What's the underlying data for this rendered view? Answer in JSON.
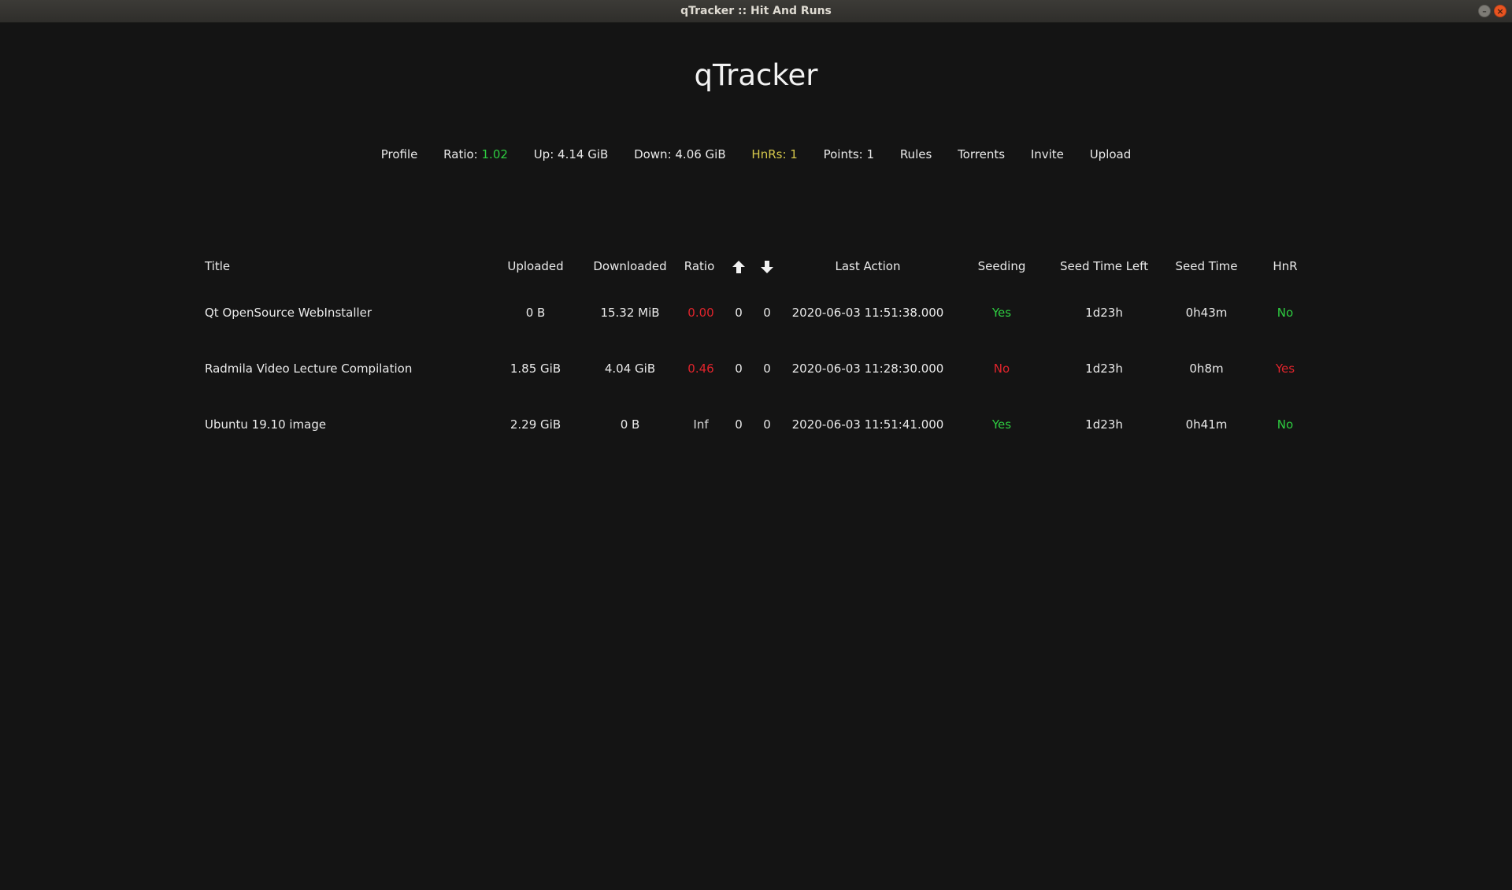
{
  "window": {
    "title": "qTracker :: Hit And Runs",
    "minimize_glyph": "–",
    "close_glyph": "×"
  },
  "app": {
    "title": "qTracker"
  },
  "nav": {
    "profile": "Profile",
    "ratio_label": "Ratio:",
    "ratio_value": "1.02",
    "up": "Up: 4.14 GiB",
    "down": "Down: 4.06 GiB",
    "hnrs": "HnRs: 1",
    "points": "Points: 1",
    "rules": "Rules",
    "torrents": "Torrents",
    "invite": "Invite",
    "upload": "Upload"
  },
  "table": {
    "headers": {
      "title": "Title",
      "uploaded": "Uploaded",
      "downloaded": "Downloaded",
      "ratio": "Ratio",
      "seeders_icon": "arrow-up-icon",
      "leechers_icon": "arrow-down-icon",
      "last_action": "Last Action",
      "seeding": "Seeding",
      "seed_time_left": "Seed Time Left",
      "seed_time": "Seed Time",
      "hnr": "HnR"
    },
    "rows": [
      {
        "title": "Qt OpenSource WebInstaller",
        "uploaded": "0 B",
        "downloaded": "15.32 MiB",
        "ratio": "0.00",
        "seeders": "0",
        "leechers": "0",
        "last_action": "2020-06-03 11:51:38.000",
        "seeding": "Yes",
        "seed_time_left": "1d23h",
        "seed_time": "0h43m",
        "hnr": "No"
      },
      {
        "title": "Radmila Video Lecture Compilation",
        "uploaded": "1.85 GiB",
        "downloaded": "4.04 GiB",
        "ratio": "0.46",
        "seeders": "0",
        "leechers": "0",
        "last_action": "2020-06-03 11:28:30.000",
        "seeding": "No",
        "seed_time_left": "1d23h",
        "seed_time": "0h8m",
        "hnr": "Yes"
      },
      {
        "title": "Ubuntu 19.10 image",
        "uploaded": "2.29 GiB",
        "downloaded": "0 B",
        "ratio": "Inf",
        "seeders": "0",
        "leechers": "0",
        "last_action": "2020-06-03 11:51:41.000",
        "seeding": "Yes",
        "seed_time_left": "1d23h",
        "seed_time": "0h41m",
        "hnr": "No"
      }
    ]
  },
  "colors": {
    "background": "#141414",
    "positive": "#2ecc40",
    "negative": "#e0242c",
    "warning": "#d6c84b"
  }
}
